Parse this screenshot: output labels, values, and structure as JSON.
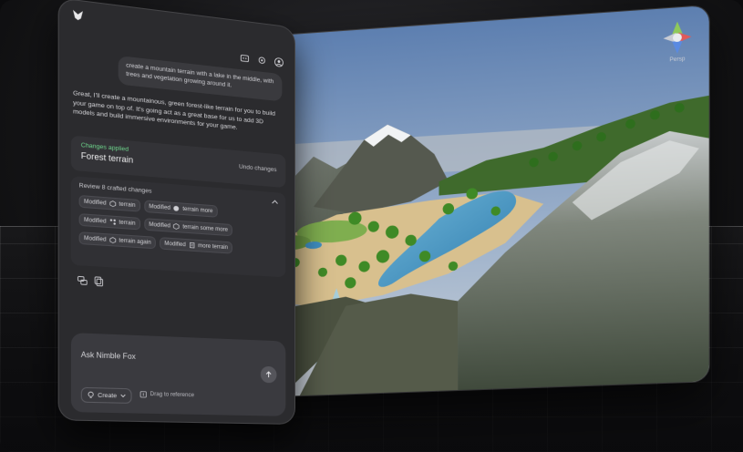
{
  "chat": {
    "user_message": "create a mountain terrain with a lake in the middle, with trees and vegetation growing around it.",
    "assistant_message": "Great, I'll create a mountainous, green forest-like terrain for you to build your game on top of. It's going act as a great base for us to add 3D models and build immersive environments for your game.",
    "changes": {
      "status": "Changes applied",
      "title": "Forest terrain",
      "undo_label": "Undo changes"
    },
    "review": {
      "header": "Review 8 crafted changes",
      "chips": [
        [
          {
            "action": "Modified",
            "target": "terrain",
            "icon": "cube-icon"
          },
          {
            "action": "Modified",
            "target": "terrain more",
            "icon": "sphere-icon"
          }
        ],
        [
          {
            "action": "Modified",
            "target": "terrain",
            "icon": "nodes-icon"
          },
          {
            "action": "Modified",
            "target": "terrain some more",
            "icon": "cube-icon"
          }
        ],
        [
          {
            "action": "Modified",
            "target": "terrain again",
            "icon": "cube-icon"
          },
          {
            "action": "Modified",
            "target": "more terrain",
            "icon": "doc-icon"
          }
        ]
      ]
    },
    "composer": {
      "placeholder": "Ask Nimble Fox",
      "mode": "Create",
      "drag_hint": "Drag to reference"
    }
  },
  "scene": {
    "gizmo_label": "Persp"
  },
  "colors": {
    "accent_green": "#6ed58c",
    "panel_bg": "#2b2b2e",
    "sky_top": "#5d7fb0",
    "sky_bottom": "#c9cfd6",
    "water": "#3f8fc2"
  }
}
